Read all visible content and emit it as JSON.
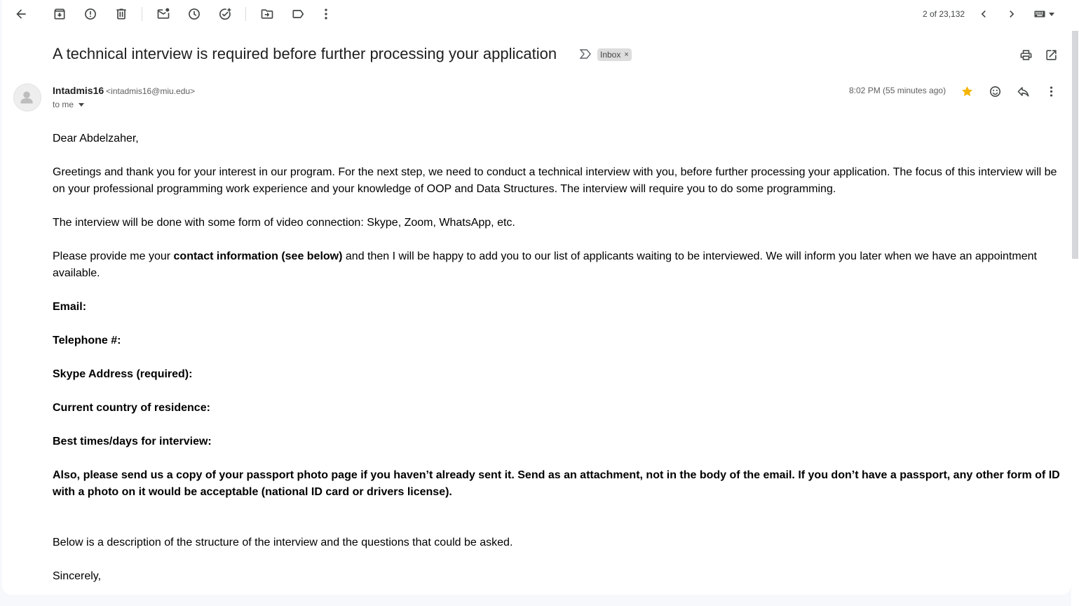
{
  "toolbar": {
    "back": "back-icon",
    "archive": "archive-icon",
    "spam": "report-spam-icon",
    "delete": "delete-icon",
    "mark_unread": "mark-unread-icon",
    "snooze": "snooze-icon",
    "add_task": "add-task-icon",
    "move_to": "move-to-icon",
    "labels": "label-icon",
    "more": "more-vert-icon",
    "pager": "2 of 23,132",
    "input_tools": "keyboard-icon"
  },
  "subject": {
    "text": "A technical interview is required before further processing your application",
    "label": "Inbox",
    "label_remove": "×"
  },
  "message": {
    "sender_name": "Intadmis16",
    "sender_email": "<intadmis16@miu.edu>",
    "to": "to me",
    "time": "8:02 PM (55 minutes ago)",
    "starred": true,
    "star_color": "#f4b400"
  },
  "body": {
    "greeting": "Dear Abdelzaher,",
    "p1": "Greetings and thank you for your interest in our program. For the next step, we need to conduct a technical interview with you, before further processing your application. The focus of this interview will be on your professional programming work experience and your knowledge of OOP and Data Structures. The interview will require you to do some programming.",
    "p2": "The interview will be done with some form of video connection:  Skype, Zoom, WhatsApp, etc.",
    "p3_pre": "Please provide me your ",
    "p3_bold": "contact information (see below)",
    "p3_post": " and then I will be happy to add you to our list of applicants waiting to be interviewed. We will inform you later when we have an appointment available.",
    "f_email": "Email:",
    "f_phone": "Telephone #:",
    "f_skype": "Skype Address (required):",
    "f_country": "Current country of residence:",
    "f_times": "Best times/days for interview:",
    "passport": "Also, please send  us a copy of your passport photo page if you haven’t already sent it.  Send as an attachment, not in the body of the email.  If you don’t have a passport, any other form of ID with a photo on it would be acceptable (national ID card or drivers license).",
    "below": "Below is a description of the structure of the interview and the questions that could be asked.",
    "closing": "Sincerely,"
  }
}
